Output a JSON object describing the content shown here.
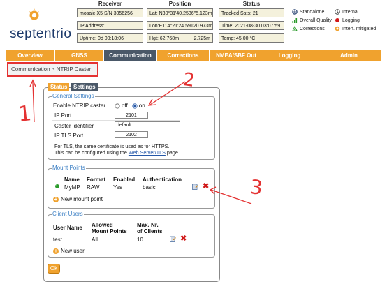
{
  "brand": {
    "logo_text": "septentrio"
  },
  "header": {
    "receiver": {
      "title": "Receiver",
      "rows": [
        "mosaic-X5 S/N 3056256",
        "IP Address:",
        "Uptime: 0d 00:18:06"
      ]
    },
    "position": {
      "title": "Position",
      "lat": "Lat: N30°31'40.2536\"5.123m",
      "lon": "Lon:E114°21'24.5912ؘ0.973m",
      "hgt_label": "Hgt: 62.768m",
      "hgt_value": "2.725m"
    },
    "status": {
      "title": "Status",
      "rows": [
        "Tracked Sats: 21",
        "Time: 2021-08-30 03:07:59",
        "Temp: 45.00 °C"
      ]
    }
  },
  "legend": {
    "standalone": "Standalone",
    "overall_quality": "Overall Quality",
    "corrections": "Corrections",
    "internal": "Internal",
    "logging": "Logging",
    "interf_mitigated": "Interf. mitigated"
  },
  "nav": [
    "Overview",
    "GNSS",
    "Communication",
    "Corrections",
    "NMEA/SBF Out",
    "Logging",
    "Admin"
  ],
  "nav_active": "Communication",
  "breadcrumb": "Communication > NTRIP Caster",
  "tabs": {
    "status": "Status",
    "settings": "Settings"
  },
  "general": {
    "title": "General Settings",
    "enable_label": "Enable NTRIP caster",
    "off_label": "off",
    "on_label": "on",
    "selected": "on",
    "ip_port_label": "IP Port",
    "ip_port_value": "2101",
    "caster_id_label": "Caster identifier",
    "caster_id_value": "default",
    "tls_port_label": "IP TLS Port",
    "tls_port_value": "2102",
    "note_line1": "For TLS, the same certificate is used as for HTTPS.",
    "note_line2_prefix": "This can be configured using the ",
    "note_link": "Web Server/TLS",
    "note_line2_suffix": " page."
  },
  "mount_points": {
    "title": "Mount Points",
    "headers": [
      "Name",
      "Format",
      "Enabled",
      "Authentication"
    ],
    "row": {
      "name": "MyMP",
      "format": "RAW",
      "enabled": "Yes",
      "authentication": "basic"
    },
    "add_label": "New mount point"
  },
  "client_users": {
    "title": "Client Users",
    "headers": {
      "user_name": "User Name",
      "allowed_1": "Allowed",
      "allowed_2": "Mount Points",
      "max_1": "Max. Nr.",
      "max_2": "of Clients"
    },
    "row": {
      "user_name": "test",
      "allowed": "All",
      "max": "10"
    },
    "add_label": "New user"
  },
  "ok_label": "Ok",
  "annotations": {
    "one": "1",
    "two": "2",
    "three": "3"
  },
  "colors": {
    "accent": "#f0a22e",
    "nav_active": "#4a5868",
    "annotation": "#e43232",
    "group_title": "#3b7fc4"
  }
}
